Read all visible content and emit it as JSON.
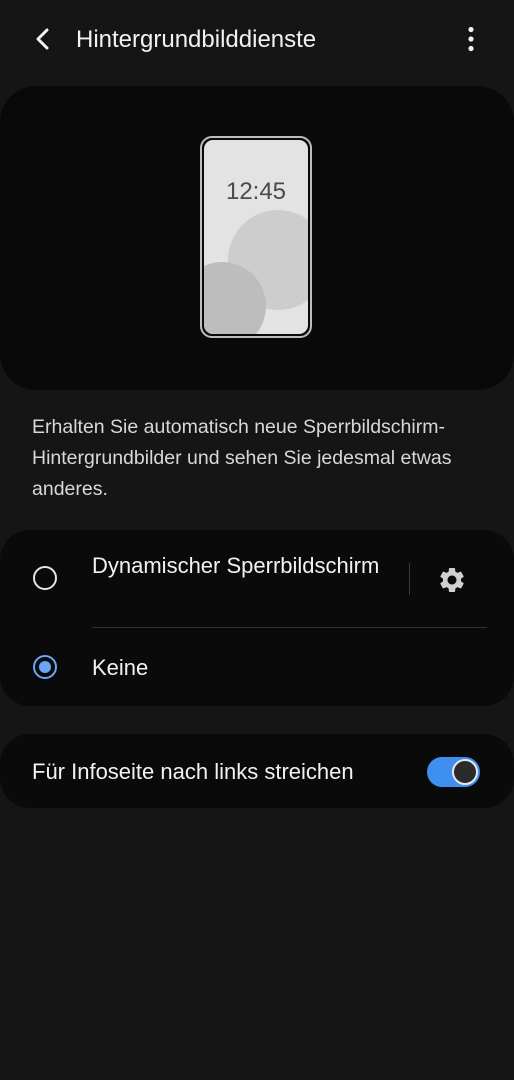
{
  "header": {
    "title": "Hintergrundbilddienste",
    "back_icon": "chevron-left-icon",
    "more_icon": "more-vertical-icon"
  },
  "preview": {
    "time": "12:45"
  },
  "description": "Erhalten Sie automatisch neue Sperrbildschirm-Hintergrundbilder und sehen Sie jedesmal etwas anderes.",
  "options": [
    {
      "label": "Dynamischer Sperrbildschirm",
      "selected": false,
      "settings_icon": "gear-icon"
    },
    {
      "label": "Keine",
      "selected": true
    }
  ],
  "swipe_setting": {
    "label": "Für Infoseite nach links streichen",
    "enabled": true
  },
  "colors": {
    "background": "#151515",
    "card": "#0a0a0a",
    "accent": "#3e8ff0",
    "radio_selected": "#6aa6f5"
  }
}
